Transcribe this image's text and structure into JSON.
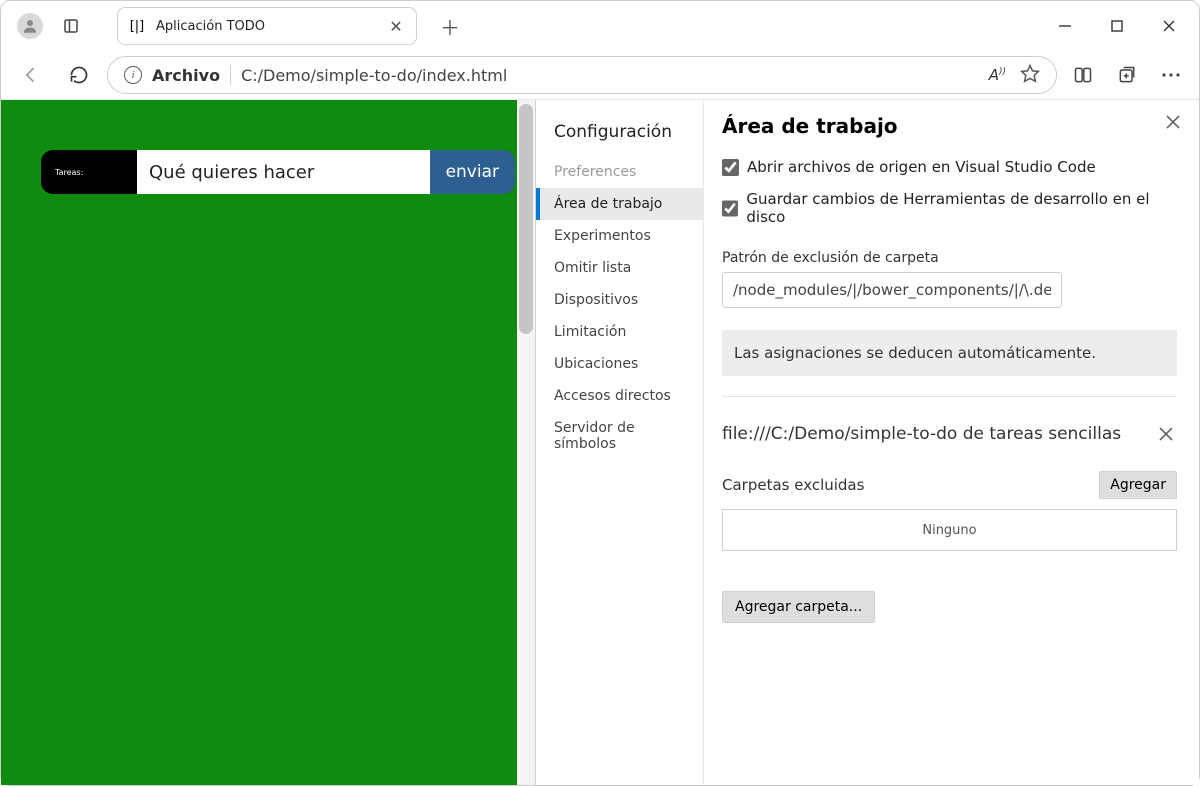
{
  "browser": {
    "tab_title": "Aplicación TODO",
    "omnibox_label": "Archivo",
    "omnibox_path": "C:/Demo/simple-to-do/index.html"
  },
  "page": {
    "input_label": "Tareas:",
    "input_value": "Qué quieres hacer",
    "submit_label": "enviar"
  },
  "sidebar": {
    "title": "Configuración",
    "items": [
      {
        "label": "Preferences",
        "muted": true
      },
      {
        "label": "Área de trabajo",
        "selected": true
      },
      {
        "label": "Experimentos"
      },
      {
        "label": "Omitir lista"
      },
      {
        "label": "Dispositivos"
      },
      {
        "label": "Limitación"
      },
      {
        "label": "Ubicaciones"
      },
      {
        "label": "Accesos directos"
      },
      {
        "label": "Servidor de símbolos"
      }
    ]
  },
  "workspace": {
    "heading": "Área de trabajo",
    "checkbox1": "Abrir archivos de origen en Visual Studio Code",
    "checkbox2": "Guardar cambios de Herramientas de desarrollo en el disco",
    "exclude_label": "Patrón de exclusión de carpeta",
    "exclude_value": "/node_modules/|/bower_components/|/\\.devtoo",
    "info_banner": "Las asignaciones se deducen automáticamente.",
    "mapping_title": "file:///C:/Demo/simple-to-do de tareas sencillas",
    "excluded_label": "Carpetas excluidas",
    "add_label": "Agregar",
    "none_label": "Ninguno",
    "add_folder_label": "Agregar carpeta..."
  }
}
